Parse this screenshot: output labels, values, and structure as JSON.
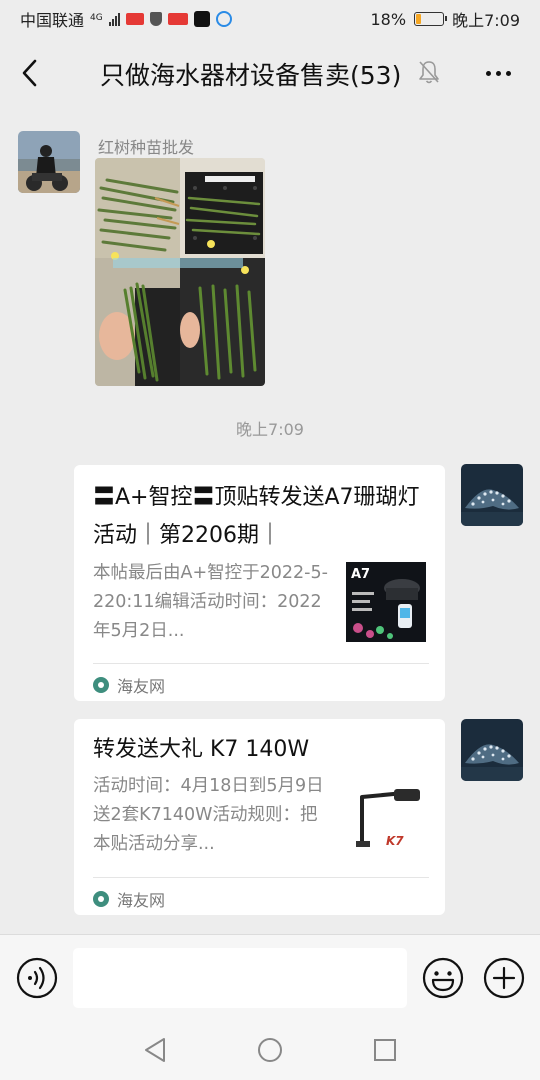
{
  "status_bar": {
    "carrier": "中国联通",
    "network": "4G",
    "battery_percent": "18%",
    "battery_level": 0.18,
    "time": "晚上7:09",
    "accent_colors": {
      "battery": "#f5a623",
      "app_badge_red": "#e53935"
    }
  },
  "header": {
    "title": "只做海水器材设备售卖(53)",
    "icons": [
      "back-arrow-icon",
      "mute-bell-icon",
      "more-icon"
    ]
  },
  "messages": {
    "first": {
      "sender": "红树种苗批发",
      "type": "image"
    },
    "timestamp": "晚上7:09",
    "card1": {
      "title": "〓A+智控〓顶贴转发送A7珊瑚灯活动｜第2206期｜",
      "desc": "本帖最后由A+智控于2022-5-220:11编辑活动时间：2022年5月2日...",
      "thumb_label": "A7",
      "source": "海友网"
    },
    "card2": {
      "title": "转发送大礼 K7 140W",
      "desc": "活动时间：4月18日到5月9日送2套K7140W活动规则：把本贴活动分享...",
      "thumb_label": "K7",
      "source": "海友网"
    }
  },
  "input_bar": {
    "value": "",
    "icons": [
      "voice-icon",
      "emoji-icon",
      "add-icon"
    ]
  },
  "system_nav": {
    "icons": [
      "back-triangle-icon",
      "home-circle-icon",
      "recents-square-icon"
    ]
  }
}
